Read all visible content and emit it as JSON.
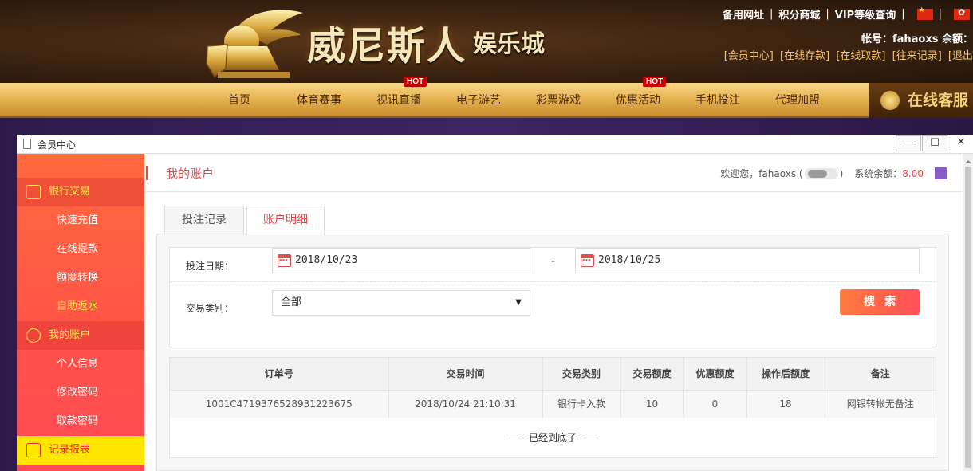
{
  "banner": {
    "logo_text": "威尼斯人",
    "logo_sub": "娱乐城",
    "top_links": [
      "备用网址",
      "积分商城",
      "VIP等级查询"
    ],
    "account_line": "帐号：fahaoxs 余额：",
    "account_links": [
      "[会员中心]",
      "[在线存款]",
      "[在线取款]",
      "[往来记录]",
      "[退出"
    ]
  },
  "nav": {
    "items": [
      "首页",
      "体育赛事",
      "视讯直播",
      "电子游艺",
      "彩票游戏",
      "优惠活动",
      "手机投注",
      "代理加盟"
    ],
    "hot_label": "HOT",
    "online_service": "在线客服"
  },
  "window": {
    "title": "会员中心",
    "min": "—",
    "max": "☐",
    "close": "✕"
  },
  "sidebar": {
    "bank": "银行交易",
    "bank_items": [
      "快速充值",
      "在线提款",
      "额度转换",
      "自助返水"
    ],
    "account": "我的账户",
    "account_items": [
      "个人信息",
      "修改密码",
      "取款密码"
    ],
    "records": "记录报表"
  },
  "header": {
    "title": "我的账户",
    "welcome_prefix": "欢迎您，fahaoxs (",
    "welcome_suffix": ")",
    "balance_label": "系统余额：",
    "balance_value": "8.00"
  },
  "tabs": [
    "投注记录",
    "账户明细"
  ],
  "filter": {
    "date_label": "投注日期：",
    "start_date": "2018/10/23",
    "date_dash": "-",
    "end_date": "2018/10/25",
    "type_label": "交易类别：",
    "type_value": "全部",
    "caret": "▼",
    "search": "搜索"
  },
  "table": {
    "headers": [
      "订单号",
      "交易时间",
      "交易类别",
      "交易额度",
      "优惠额度",
      "操作后额度",
      "备注"
    ],
    "rows": [
      [
        "1001C4719376528931223675",
        "2018/10/24 21:10:31",
        "银行卡入款",
        "10",
        "0",
        "18",
        "网银转帐无备注"
      ]
    ],
    "end_text": "——已经到底了——"
  },
  "colors": {
    "accent": "#e34a4a",
    "sidebar_top": "#ff6a3d",
    "sidebar_bottom": "#ff4a57",
    "active_yellow": "#ffe600"
  }
}
